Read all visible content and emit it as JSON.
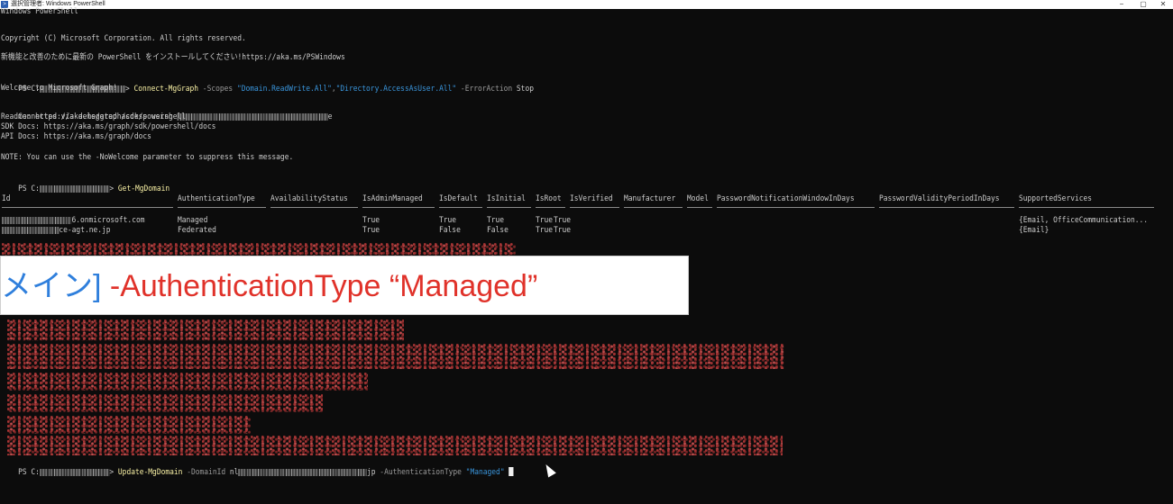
{
  "window": {
    "title": "選択管理者: Windows PowerShell",
    "icon": "powershell-icon",
    "controls": [
      "−",
      "▢",
      "✕"
    ]
  },
  "console": {
    "banner": [
      "Windows PowerShell",
      "Copyright (C) Microsoft Corporation. All rights reserved."
    ],
    "install_msg": "新機能と改善のために最新の PowerShell をインストールしてください!https://aka.ms/PSWindows",
    "cmd1": {
      "prompt": "PS C:",
      "sep": "> ",
      "name": "Connect-MgGraph",
      "p1": " -Scopes ",
      "v1": "\"Domain.ReadWrite.All\"",
      "comma": ",",
      "v2": "\"Directory.AccessAsUser.All\"",
      "p2": " -ErrorAction ",
      "v3": "Stop"
    },
    "welcome": "Welcome to Microsoft Graph!",
    "connected": "Connected via delegated access using ",
    "connected_tail": "e",
    "readme": "Readme: https://aka.ms/graph/sdk/powershell",
    "sdk_docs": "SDK Docs: https://aka.ms/graph/sdk/powershell/docs",
    "api_docs": "API Docs: https://aka.ms/graph/docs",
    "note": "NOTE: You can use the -NoWelcome parameter to suppress this message.",
    "cmd2": {
      "prompt": "PS C:",
      "sep": "> ",
      "name": "Get-MgDomain"
    },
    "table": {
      "headers": [
        "Id",
        "AuthenticationType",
        "AvailabilityStatus",
        "IsAdminManaged",
        "IsDefault",
        "IsInitial",
        "IsRoot",
        "IsVerified",
        "Manufacturer",
        "Model",
        "PasswordNotificationWindowInDays",
        "PasswordValidityPeriodInDays",
        "SupportedServices"
      ],
      "rows": [
        [
          "6.onmicrosoft.com",
          "Managed",
          "",
          "True",
          "True",
          "True",
          "True",
          "True",
          "",
          "",
          "",
          "",
          "{Email, OfficeCommunication..."
        ],
        [
          "ce-agt.ne.jp",
          "Federated",
          "",
          "True",
          "False",
          "False",
          "True",
          "True",
          "",
          "",
          "",
          "",
          "{Email}"
        ]
      ]
    },
    "cmd3": {
      "prompt": "PS C:",
      "sep": "> ",
      "name": "Update-MgDomain",
      "p1": " -DomainId ",
      "v1": "nl",
      "v1_tail": "jp",
      "p2": " -AuthenticationType ",
      "v2": "\"Managed\""
    }
  },
  "overlay": {
    "part_a": "メイン]",
    "part_b": " -AuthenticationType “Managed”"
  },
  "colors": {
    "background": "#0c0c0c",
    "text": "#cccccc",
    "command": "#f9f1a5",
    "param": "#9a9a9a",
    "string": "#3a96dd",
    "overlay_blue": "#2f7fdc",
    "overlay_red": "#e0322a"
  }
}
